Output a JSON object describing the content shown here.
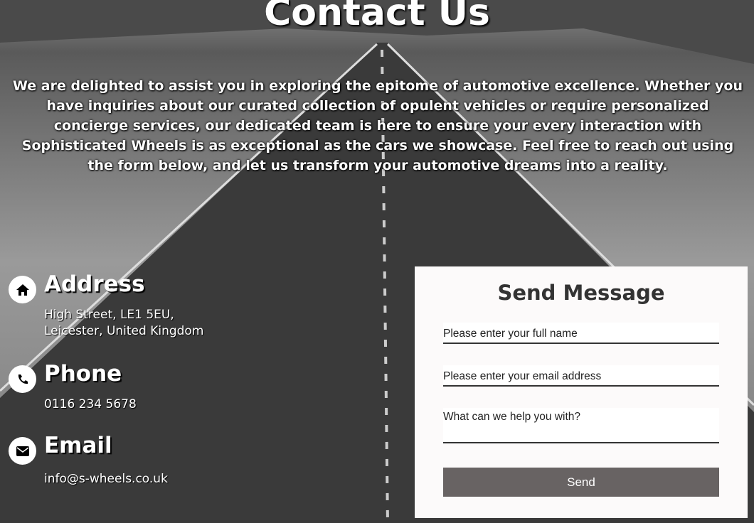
{
  "page": {
    "title": "Contact Us",
    "intro": "We are delighted to assist you in exploring the epitome of automotive excellence. Whether you have inquiries about our curated collection of opulent vehicles or require personalized concierge services, our dedicated team is here to ensure your every interaction with Sophisticated Wheels is as exceptional as the cars we showcase. Feel free to reach out using the form below, and let us transform your automotive dreams into a reality."
  },
  "contact": {
    "address": {
      "icon": "home-icon",
      "heading": "Address",
      "line1": "High Street, LE1 5EU,",
      "line2": "Leicester, United Kingdom"
    },
    "phone": {
      "icon": "phone-icon",
      "heading": "Phone",
      "value": "0116 234 5678"
    },
    "email": {
      "icon": "envelope-icon",
      "heading": "Email",
      "value": "info@s-wheels.co.uk"
    }
  },
  "form": {
    "title": "Send Message",
    "name_placeholder": "Please enter your full name",
    "email_placeholder": "Please enter your email address",
    "message_placeholder": "What can we help you with?",
    "send_label": "Send",
    "button_color": "#686363"
  }
}
